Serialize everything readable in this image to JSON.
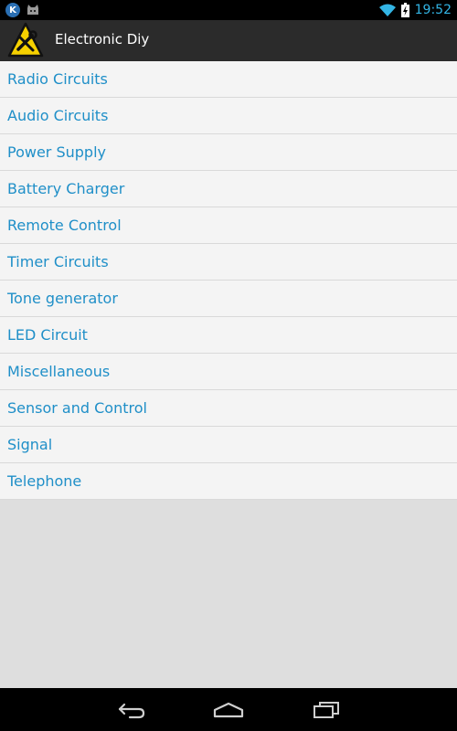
{
  "status_bar": {
    "left_icons": [
      "k-icon",
      "cat-icon"
    ],
    "k_letter": "K",
    "time": "19:52",
    "accent_color": "#33b5e5"
  },
  "action_bar": {
    "title": "Electronic Diy",
    "logo_icon": "warning-tools-icon"
  },
  "list": {
    "items": [
      {
        "label": "Radio Circuits"
      },
      {
        "label": "Audio Circuits"
      },
      {
        "label": "Power Supply"
      },
      {
        "label": "Battery Charger"
      },
      {
        "label": "Remote Control"
      },
      {
        "label": "Timer Circuits"
      },
      {
        "label": "Tone generator"
      },
      {
        "label": "LED Circuit"
      },
      {
        "label": "Miscellaneous"
      },
      {
        "label": "Sensor and Control"
      },
      {
        "label": "Signal"
      },
      {
        "label": "Telephone"
      }
    ],
    "text_color": "#1f8fc8"
  },
  "nav_bar": {
    "buttons": [
      "back-icon",
      "home-icon",
      "recents-icon"
    ]
  }
}
